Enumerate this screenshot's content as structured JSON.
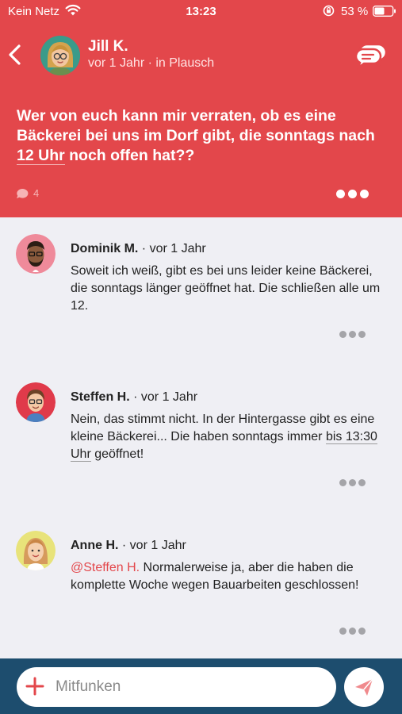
{
  "status_bar": {
    "carrier": "Kein Netz",
    "time": "13:23",
    "battery": "53 %"
  },
  "post": {
    "author": "Jill K.",
    "meta": "vor 1 Jahr · in Plausch",
    "text_before": "Wer von euch kann mir verraten, ob es eine Bäckerei bei uns im Dorf gibt, die sonntags nach ",
    "text_link": "12 Uhr",
    "text_after": " noch offen hat??",
    "comment_count": "4"
  },
  "comments": [
    {
      "author": "Dominik M.",
      "time": "· vor 1 Jahr",
      "text": "Soweit ich weiß, gibt es bei uns leider keine Bäckerei, die sonntags länger geöffnet hat. Die schließen alle um 12."
    },
    {
      "author": "Steffen H.",
      "time": "· vor 1 Jahr",
      "text_before": "Nein, das stimmt nicht. In der Hintergasse gibt es eine kleine Bäckerei... Die haben sonntags immer ",
      "text_link": "bis 13:30 Uhr",
      "text_after": " geöffnet!"
    },
    {
      "author": "Anne H.",
      "time": "· vor 1 Jahr",
      "mention": "@Steffen H.",
      "text": " Normalerweise ja, aber die haben die komplette Woche wegen Bauarbeiten geschlossen!"
    }
  ],
  "composer": {
    "placeholder": "Mitfunken"
  },
  "colors": {
    "header": "#e3474b",
    "background": "#efeff4",
    "composer": "#1d4d6e",
    "mention": "#e3474b"
  },
  "icons": {
    "back": "chevron-left-icon",
    "chat": "chat-bubbles-icon",
    "comments": "comment-bubble-icon",
    "more": "more-dots-icon",
    "add": "plus-icon",
    "send": "send-plane-icon"
  }
}
